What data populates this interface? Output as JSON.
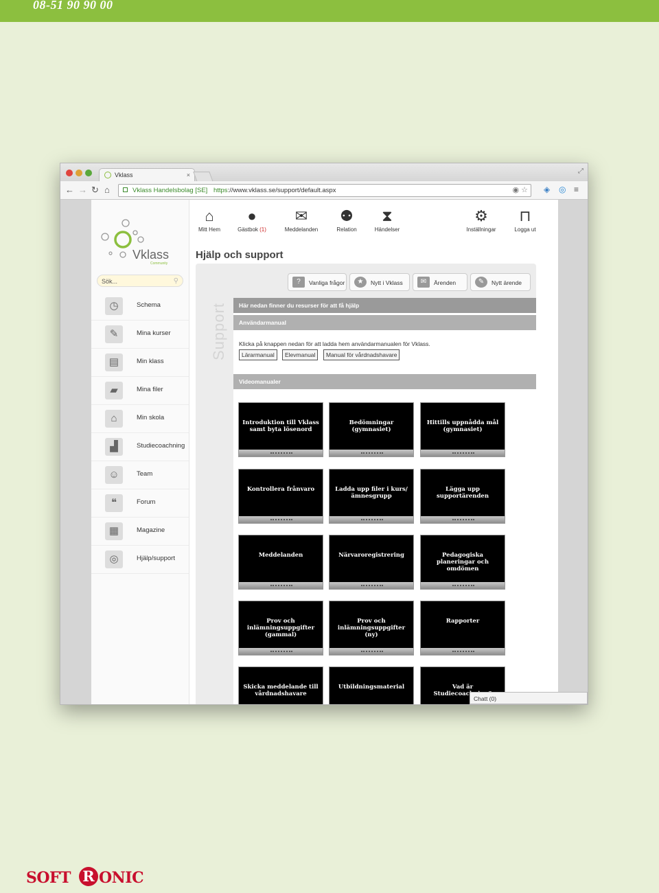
{
  "header": {
    "phone": "08-51 90 90 00"
  },
  "browser": {
    "tab_title": "Vklass",
    "tab_close": "×",
    "url_security": "Vklass Handelsbolag [SE]",
    "url_scheme": "https",
    "url_rest": "://www.vklass.se/support/default.aspx"
  },
  "sidebar": {
    "logo_text": "Vklass",
    "logo_sub": "Community",
    "search_placeholder": "Sök...",
    "items": [
      {
        "label": "Schema",
        "icon": "calendar-clock-icon"
      },
      {
        "label": "Mina kurser",
        "icon": "pen-icon"
      },
      {
        "label": "Min klass",
        "icon": "id-card-icon"
      },
      {
        "label": "Mina filer",
        "icon": "folder-icon"
      },
      {
        "label": "Min skola",
        "icon": "school-icon"
      },
      {
        "label": "Studiecoachning",
        "icon": "stairs-icon"
      },
      {
        "label": "Team",
        "icon": "team-icon"
      },
      {
        "label": "Forum",
        "icon": "speech-bubble-icon"
      },
      {
        "label": "Magazine",
        "icon": "magazine-icon"
      },
      {
        "label": "Hjälp/support",
        "icon": "lifebuoy-icon"
      }
    ]
  },
  "topnav": {
    "mitt_hem": "Mitt Hem",
    "gastbok": "Gästbok",
    "gastbok_count": "(1)",
    "meddelanden": "Meddelanden",
    "relation": "Relation",
    "handelser": "Händelser",
    "installningar": "Inställningar",
    "logga_ut": "Logga ut"
  },
  "main": {
    "title": "Hjälp och support",
    "vertical_logo": "Support",
    "actions": {
      "faq": "Vanliga frågor",
      "news": "Nytt i Vklass",
      "cases": "Ärenden",
      "new_case": "Nytt ärende"
    },
    "intro_bar": "Här nedan finner du resurser för att få hjälp",
    "manual_bar": "Användarmanual",
    "manual_text": "Klicka på knappen nedan för att ladda hem användarmanualen för Vklass.",
    "manual_buttons": {
      "teacher": "Lärarmanual",
      "student": "Elevmanual",
      "guardian": "Manual för vårdnadshavare"
    },
    "video_bar": "Videomanualer",
    "videos": [
      "Introduktion till Vklass samt byta lösenord",
      "Bedömningar (gymnasiet)",
      "Hittills uppnådda mål (gymnasiet)",
      "Kontrollera frånvaro",
      "Ladda upp filer i kurs/ämnesgrupp",
      "Lägga upp supportärenden",
      "Meddelanden",
      "Närvaroregistrering",
      "Pedagogiska planeringar och omdömen",
      "Prov och inlämningsuppgifter (gammal)",
      "Prov och inlämningsuppgifter (ny)",
      "Rapporter",
      "Skicka meddelande till vårdnadshavare",
      "Utbildningsmaterial",
      "Vad är Studiecoachning?"
    ]
  },
  "chat": {
    "label": "Chatt (0)"
  },
  "footer": {
    "brand_left": "SOFT",
    "brand_mid": "R",
    "brand_right": "ONIC"
  },
  "colors": {
    "brand_green": "#8cbf3f",
    "page_background": "#e9f0d8",
    "brand_red": "#c8102e",
    "section_bar_gray": "#a8a8a8"
  }
}
